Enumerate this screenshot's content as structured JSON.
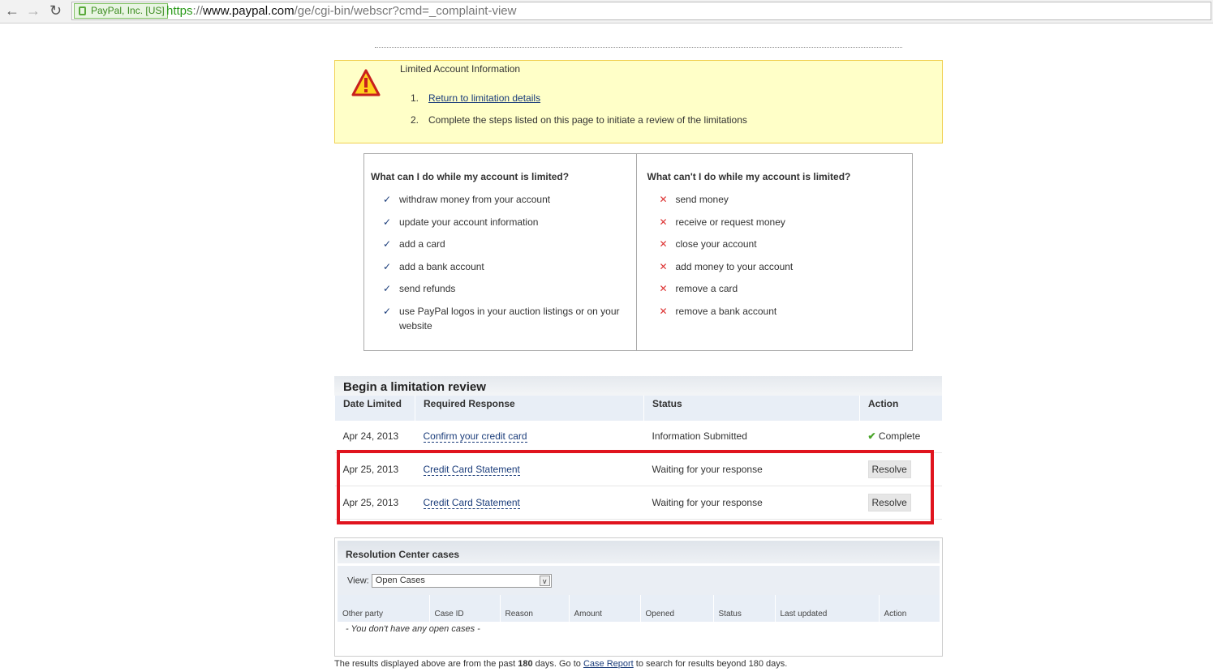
{
  "browser": {
    "ev_label": "PayPal, Inc. [US]",
    "url_scheme": "https",
    "url_sep": "://",
    "url_host": "www.paypal.com",
    "url_path": "/ge/cgi-bin/webscr?cmd=_complaint-view"
  },
  "notice": {
    "title": "Limited Account Information",
    "steps": [
      {
        "num": "1.",
        "text": "Return to limitation details",
        "link": true
      },
      {
        "num": "2.",
        "text": "Complete the steps listed on this page to initiate a review of the limitations",
        "link": false
      }
    ]
  },
  "can": {
    "title": "What can I do while my account is limited?",
    "items": [
      "withdraw money from your account",
      "update your account information",
      "add a card",
      "add a bank account",
      "send refunds",
      "use PayPal logos in your auction listings or on your website"
    ]
  },
  "cannot": {
    "title": "What can't I do while my account is limited?",
    "items": [
      "send money",
      "receive or request money",
      "close your account",
      "add money to your account",
      "remove a card",
      "remove a bank account"
    ]
  },
  "review": {
    "title": "Begin a limitation review",
    "headers": [
      "Date Limited",
      "Required Response",
      "Status",
      "Action"
    ],
    "rows": [
      {
        "date": "Apr 24, 2013",
        "response": "Confirm your credit card",
        "status": "Information Submitted",
        "action": "Complete"
      },
      {
        "date": "Apr 25, 2013",
        "response": "Credit Card Statement",
        "status": "Waiting for your response",
        "action": "Resolve"
      },
      {
        "date": "Apr 25, 2013",
        "response": "Credit Card Statement",
        "status": "Waiting for your response",
        "action": "Resolve"
      }
    ]
  },
  "cases": {
    "title": "Resolution Center cases",
    "view_label": "View:",
    "view_value": "Open Cases",
    "headers": [
      "Other party",
      "Case ID",
      "Reason",
      "Amount",
      "Opened",
      "Status",
      "Last updated",
      "Action"
    ],
    "empty": "- You don't have any open cases -"
  },
  "footer": {
    "pre": "The results displayed above are from the past ",
    "days": "180",
    "mid": " days. Go to ",
    "link": "Case Report",
    "post": " to search for results beyond 180 days."
  }
}
